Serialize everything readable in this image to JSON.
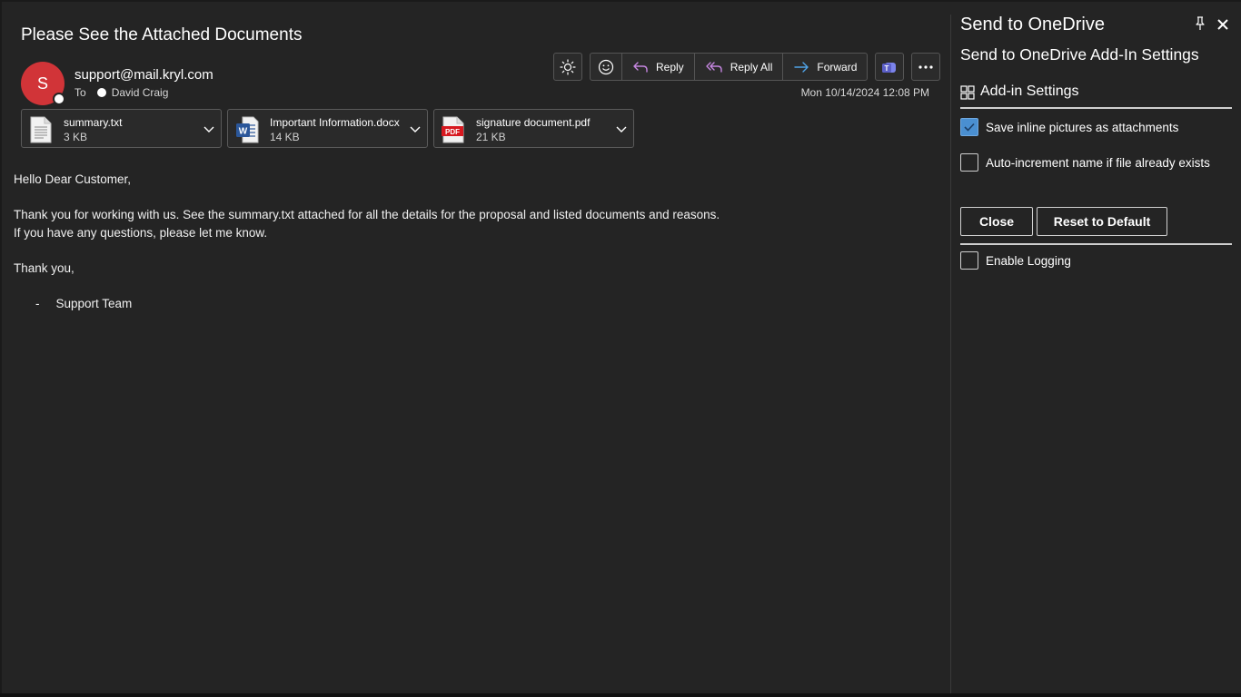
{
  "email": {
    "subject": "Please See the Attached Documents",
    "avatar_initial": "S",
    "sender": "support@mail.kryl.com",
    "to_label": "To",
    "recipient": "David Craig",
    "date": "Mon 10/14/2024 12:08 PM",
    "toolbar": {
      "reply": "Reply",
      "reply_all": "Reply All",
      "forward": "Forward"
    },
    "attachments": [
      {
        "name": "summary.txt",
        "size": "3 KB",
        "icon": "text-file-icon"
      },
      {
        "name": "Important Information.docx",
        "size": "14 KB",
        "icon": "word-file-icon"
      },
      {
        "name": "signature document.pdf",
        "size": "21 KB",
        "icon": "pdf-file-icon"
      }
    ],
    "body": {
      "greeting": "Hello Dear Customer,",
      "line1": "Thank you for working with us. See the summary.txt attached for all the details for the proposal and listed documents and reasons.",
      "line2": "If you have any questions, please let me know.",
      "closing": "Thank you,",
      "sig_dash": "-",
      "signature": "Support Team"
    }
  },
  "addin": {
    "pane_title": "Send to OneDrive",
    "settings_title": "Send to OneDrive Add-In Settings",
    "section_title": "Add-in Settings",
    "options": [
      {
        "label": "Save inline pictures as attachments",
        "checked": true
      },
      {
        "label": "Auto-increment name if file already exists",
        "checked": false
      }
    ],
    "close_label": "Close",
    "reset_label": "Reset to Default",
    "logging_label": "Enable Logging",
    "logging_checked": false
  },
  "colors": {
    "background": "#242424",
    "avatar": "#d13438",
    "checkbox_on": "#4a8fd1",
    "reply_arrow": "#c586e0",
    "forward_arrow": "#4fa3e8",
    "teams": "#5b5fc7"
  }
}
